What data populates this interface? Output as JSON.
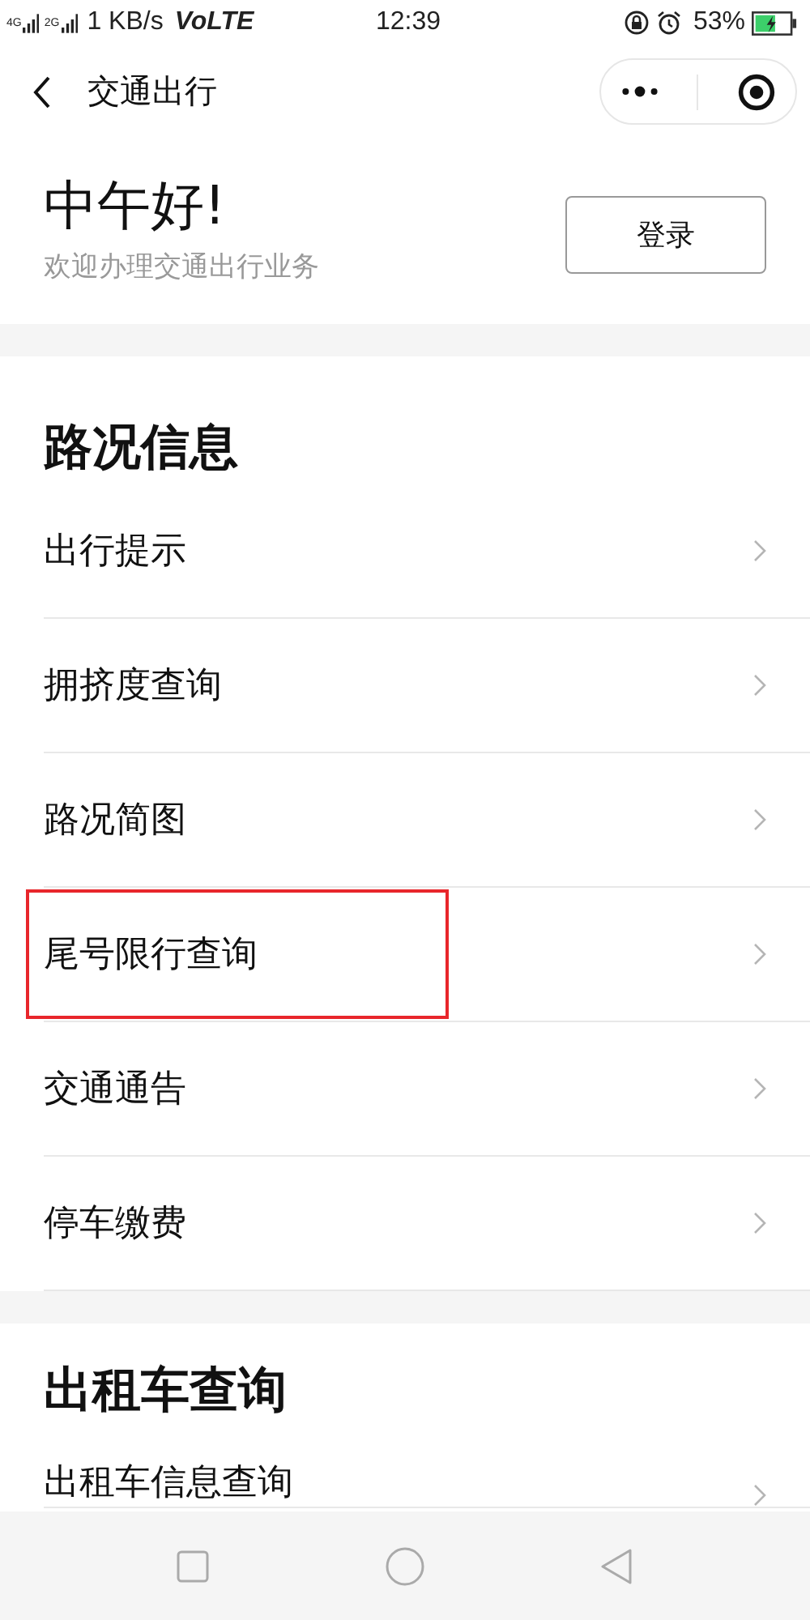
{
  "status_bar": {
    "network_1": "4G",
    "network_2": "2G",
    "speed": "1 KB/s",
    "volte": "VoLTE",
    "time": "12:39",
    "battery": "53%"
  },
  "header": {
    "title": "交通出行"
  },
  "greeting": {
    "title": "中午好!",
    "subtitle": "欢迎办理交通出行业务",
    "login_button": "登录"
  },
  "sections": [
    {
      "title": "路况信息",
      "items": [
        {
          "label": "出行提示",
          "highlighted": false
        },
        {
          "label": "拥挤度查询",
          "highlighted": false
        },
        {
          "label": "路况简图",
          "highlighted": false
        },
        {
          "label": "尾号限行查询",
          "highlighted": true
        },
        {
          "label": "交通通告",
          "highlighted": false
        },
        {
          "label": "停车缴费",
          "highlighted": false
        }
      ]
    },
    {
      "title": "出租车查询",
      "items": [
        {
          "label": "出租车信息查询",
          "highlighted": false
        }
      ]
    }
  ]
}
